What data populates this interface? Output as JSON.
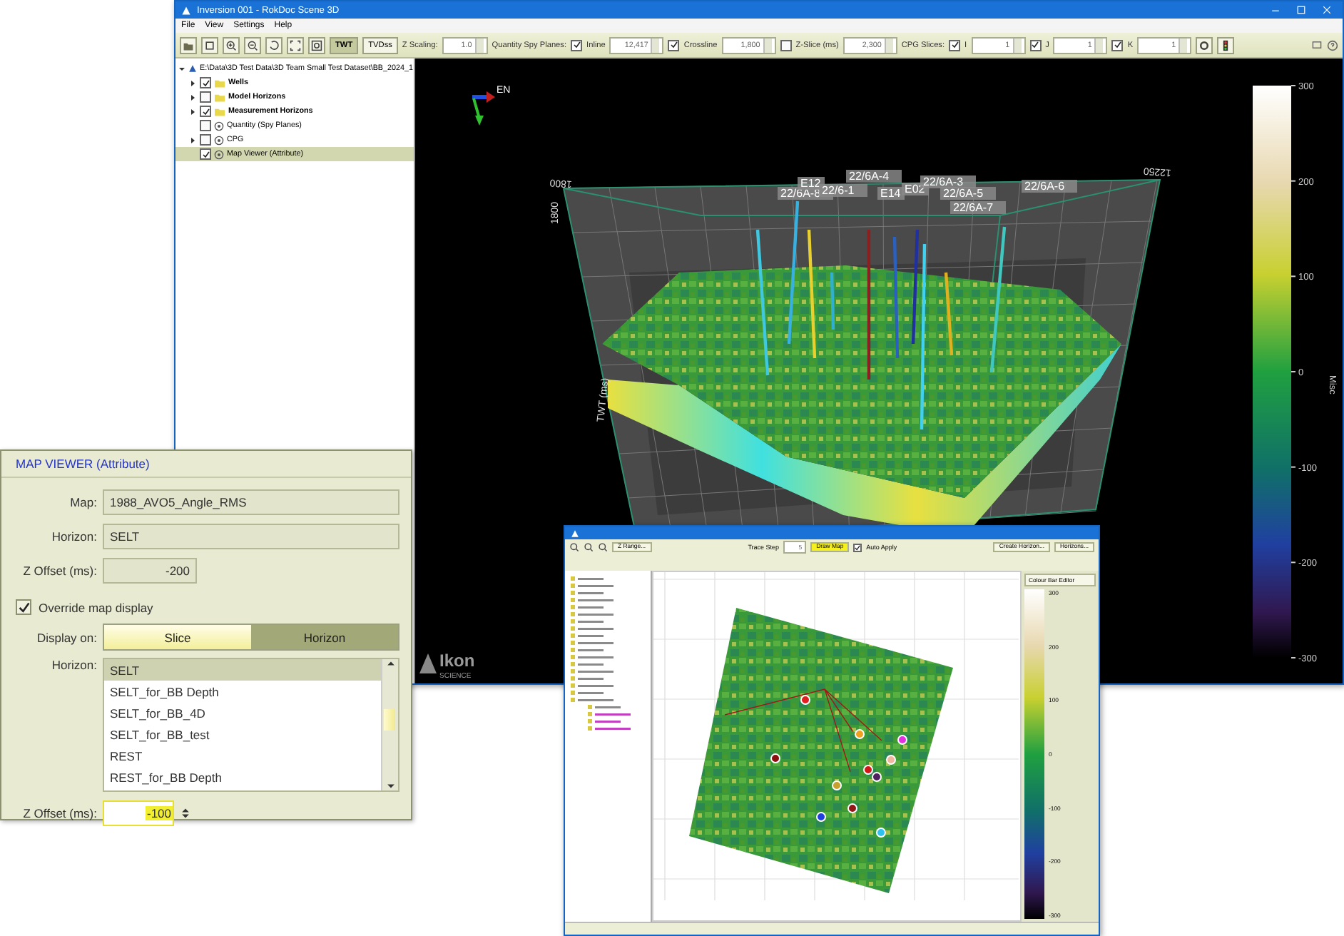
{
  "main_window": {
    "title": "Inversion 001 - RokDoc Scene 3D",
    "menu": [
      "File",
      "View",
      "Settings",
      "Help"
    ],
    "toolbar": {
      "modes": [
        {
          "label": "TWT",
          "selected": true
        },
        {
          "label": "TVDss",
          "selected": false
        }
      ],
      "z_scaling": {
        "label": "Z Scaling:",
        "value": "1.0"
      },
      "spy_planes": {
        "label": "Quantity Spy Planes:",
        "items": [
          {
            "label": "Inline",
            "checked": true,
            "value": "12,417"
          },
          {
            "label": "Crossline",
            "checked": true,
            "value": "1,800"
          },
          {
            "label": "Z-Slice (ms)",
            "checked": false,
            "value": "2,300"
          }
        ]
      },
      "cpg_slices": {
        "label": "CPG Slices:",
        "items": [
          {
            "label": "I",
            "checked": true,
            "value": "1"
          },
          {
            "label": "J",
            "checked": true,
            "value": "1"
          },
          {
            "label": "K",
            "checked": true,
            "value": "1"
          }
        ]
      }
    },
    "tree": {
      "root": "E:\\Data\\3D Test Data\\3D Team Small Test Dataset\\BB_2024_1",
      "children": [
        {
          "label": "Wells",
          "kind": "folder",
          "checked": true,
          "expandable": true,
          "selected": false
        },
        {
          "label": "Model Horizons",
          "kind": "folder",
          "checked": false,
          "expandable": true,
          "selected": false
        },
        {
          "label": "Measurement Horizons",
          "kind": "folder",
          "checked": true,
          "expandable": true,
          "selected": false
        },
        {
          "label": "Quantity (Spy Planes)",
          "kind": "node",
          "checked": false,
          "expandable": false,
          "selected": false
        },
        {
          "label": "CPG",
          "kind": "node",
          "checked": false,
          "expandable": true,
          "selected": false
        },
        {
          "label": "Map Viewer (Attribute)",
          "kind": "node",
          "checked": true,
          "expandable": false,
          "selected": true
        }
      ]
    },
    "scene": {
      "orientation": "EN",
      "well_labels": [
        "22/6A-8",
        "E12",
        "22/6-1",
        "22/6A-4",
        "E14",
        "E02",
        "22/6A-3",
        "22/6A-5",
        "22/6A-7",
        "22/6A-6"
      ],
      "axis_labels": [
        "1800",
        "1800",
        "12250",
        "TWT (ms)"
      ],
      "colorbar": {
        "title": "Misc",
        "ticks": [
          "300",
          "200",
          "100",
          "0",
          "-100",
          "-200",
          "-300"
        ]
      },
      "logo": {
        "name": "Ikon",
        "tagline": "SCIENCE"
      }
    }
  },
  "map_viewer_panel": {
    "title": "MAP VIEWER (Attribute)",
    "fields": [
      {
        "label": "Map:",
        "value": "1988_AVO5_Angle_RMS"
      },
      {
        "label": "Horizon:",
        "value": "SELT"
      },
      {
        "label": "Z Offset (ms):",
        "value": "-200"
      }
    ],
    "override": {
      "label": "Override map display",
      "checked": true
    },
    "display_on": {
      "label": "Display on:",
      "options": [
        {
          "label": "Slice",
          "selected": true
        },
        {
          "label": "Horizon",
          "selected": false
        }
      ]
    },
    "horizon_list": {
      "label": "Horizon:",
      "items": [
        {
          "label": "SELT",
          "selected": true
        },
        {
          "label": "SELT_for_BB Depth",
          "selected": false
        },
        {
          "label": "SELT_for_BB_4D",
          "selected": false
        },
        {
          "label": "SELT_for_BB_test",
          "selected": false
        },
        {
          "label": "REST",
          "selected": false
        },
        {
          "label": "REST_for_BB Depth",
          "selected": false
        }
      ]
    },
    "z_offset": {
      "label": "Z Offset (ms):",
      "value": "-100"
    }
  },
  "map_window": {
    "buttons": [
      "Z Range...",
      "Create Horizon...",
      "Horizons..."
    ],
    "draw_map": "Draw Map",
    "trace_step": {
      "label": "Trace Step",
      "value": "5"
    },
    "auto_apply": {
      "label": "Auto Apply",
      "checked": true
    },
    "colour_bar_editor": "Colour Bar Editor",
    "colorbar_ticks": [
      "300",
      "200",
      "100",
      "0",
      "-100",
      "-200",
      "-300"
    ],
    "wells": [
      {
        "color": "#e02020"
      },
      {
        "color": "#f0a020"
      },
      {
        "color": "#e030e0"
      },
      {
        "color": "#8a1010"
      },
      {
        "color": "#f0b8a0"
      },
      {
        "color": "#d01818"
      },
      {
        "color": "#502060"
      },
      {
        "color": "#c8a030"
      },
      {
        "color": "#2040e0"
      },
      {
        "color": "#30c0f0"
      },
      {
        "color": "#901818"
      }
    ]
  }
}
